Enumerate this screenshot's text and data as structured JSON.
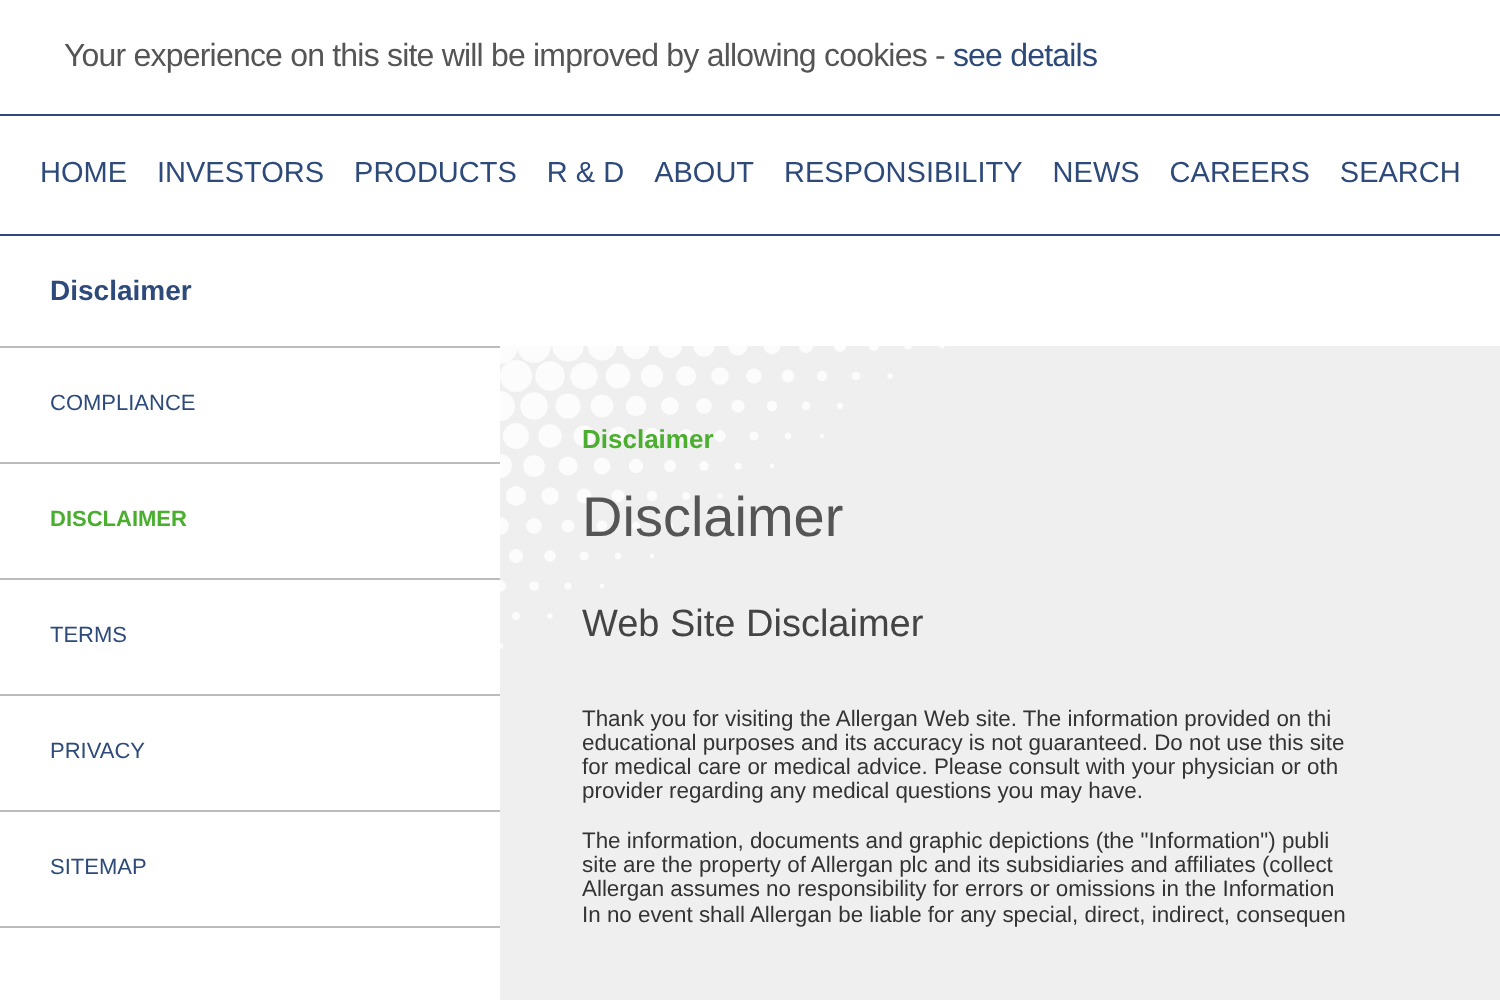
{
  "cookie_bar": {
    "text": "Your experience on this site will be improved by allowing cookies - ",
    "link": "see details"
  },
  "nav": [
    "HOME",
    "INVESTORS",
    "PRODUCTS",
    "R & D",
    "ABOUT",
    "RESPONSIBILITY",
    "NEWS",
    "CAREERS",
    "SEARCH"
  ],
  "page_title": "Disclaimer",
  "sidebar": {
    "items": [
      {
        "label": "COMPLIANCE",
        "selected": false
      },
      {
        "label": "DISCLAIMER",
        "selected": true
      },
      {
        "label": "TERMS",
        "selected": false
      },
      {
        "label": "PRIVACY",
        "selected": false
      },
      {
        "label": "SITEMAP",
        "selected": false
      }
    ]
  },
  "content": {
    "breadcrumb": "Disclaimer",
    "heading": "Disclaimer",
    "subheading": "Web Site Disclaimer",
    "paragraphs": [
      [
        "Thank you for visiting the Allergan Web site. The information provided on thi",
        "educational purposes and its accuracy is not guaranteed. Do not use this site",
        "for medical care or medical advice. Please consult with your physician or oth",
        "provider regarding any medical questions you may have."
      ],
      [
        "The information, documents and graphic depictions (the \"Information\") publi",
        "site are the property of Allergan plc and its subsidiaries and affiliates (collect",
        "Allergan assumes no responsibility for errors or omissions in the Information",
        "In no event shall Allergan be liable for any special, direct, indirect, consequen"
      ]
    ]
  }
}
